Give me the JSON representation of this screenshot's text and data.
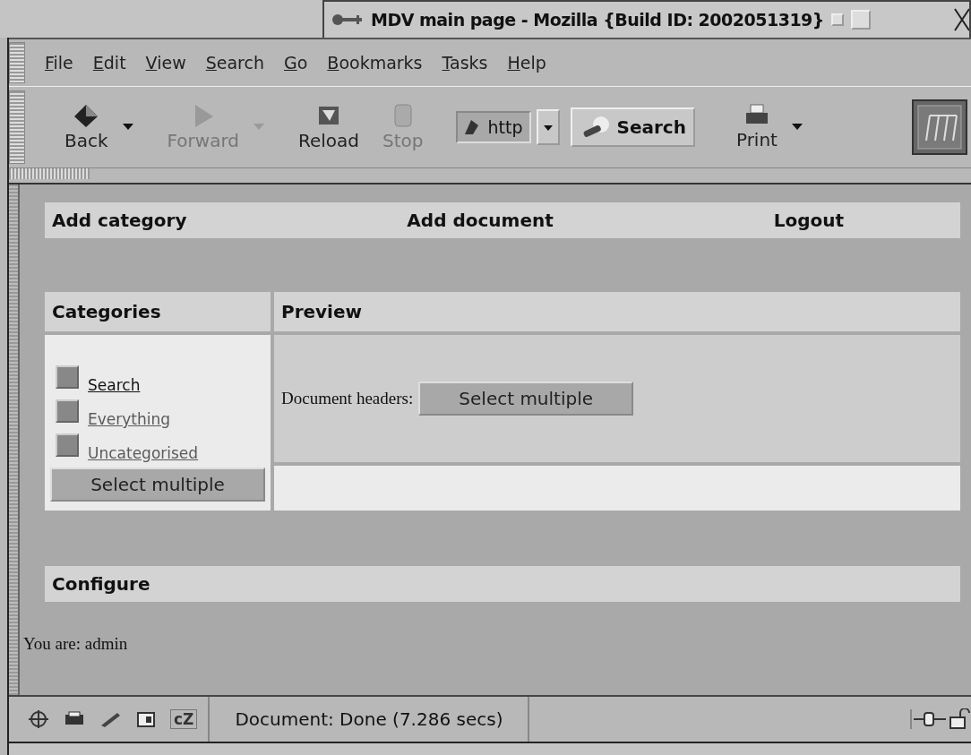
{
  "window": {
    "title": "MDV main page - Mozilla {Build ID: 2002051319}"
  },
  "menu": [
    {
      "label": "File"
    },
    {
      "label": "Edit"
    },
    {
      "label": "View"
    },
    {
      "label": "Search"
    },
    {
      "label": "Go"
    },
    {
      "label": "Bookmarks"
    },
    {
      "label": "Tasks"
    },
    {
      "label": "Help"
    }
  ],
  "toolbar": {
    "buttons": [
      {
        "label": "Back",
        "kind": "back",
        "disabled": false
      },
      {
        "label": "Forward",
        "kind": "forward",
        "disabled": true
      },
      {
        "label": "Reload",
        "kind": "reload",
        "disabled": false
      },
      {
        "label": "Stop",
        "kind": "stop",
        "disabled": true
      }
    ],
    "url": {
      "value": "http"
    },
    "search_button": "Search",
    "print": "Print"
  },
  "page": {
    "nav": [
      "Add category",
      "Add document",
      "Logout"
    ],
    "categories": {
      "heading": "Categories",
      "items": [
        {
          "label": "Search",
          "checked": false,
          "dimmed": false
        },
        {
          "label": "Everything",
          "checked": false,
          "dimmed": true
        },
        {
          "label": "Uncategorised",
          "checked": false,
          "dimmed": true
        }
      ],
      "button": "Select multiple"
    },
    "preview": {
      "heading": "Preview",
      "label": "Document headers:",
      "button": "Select multiple"
    },
    "configure": "Configure",
    "user_line": "You are: admin"
  },
  "status_bar": {
    "chat_label": "cZ",
    "text": "Document: Done (7.286 secs)"
  }
}
